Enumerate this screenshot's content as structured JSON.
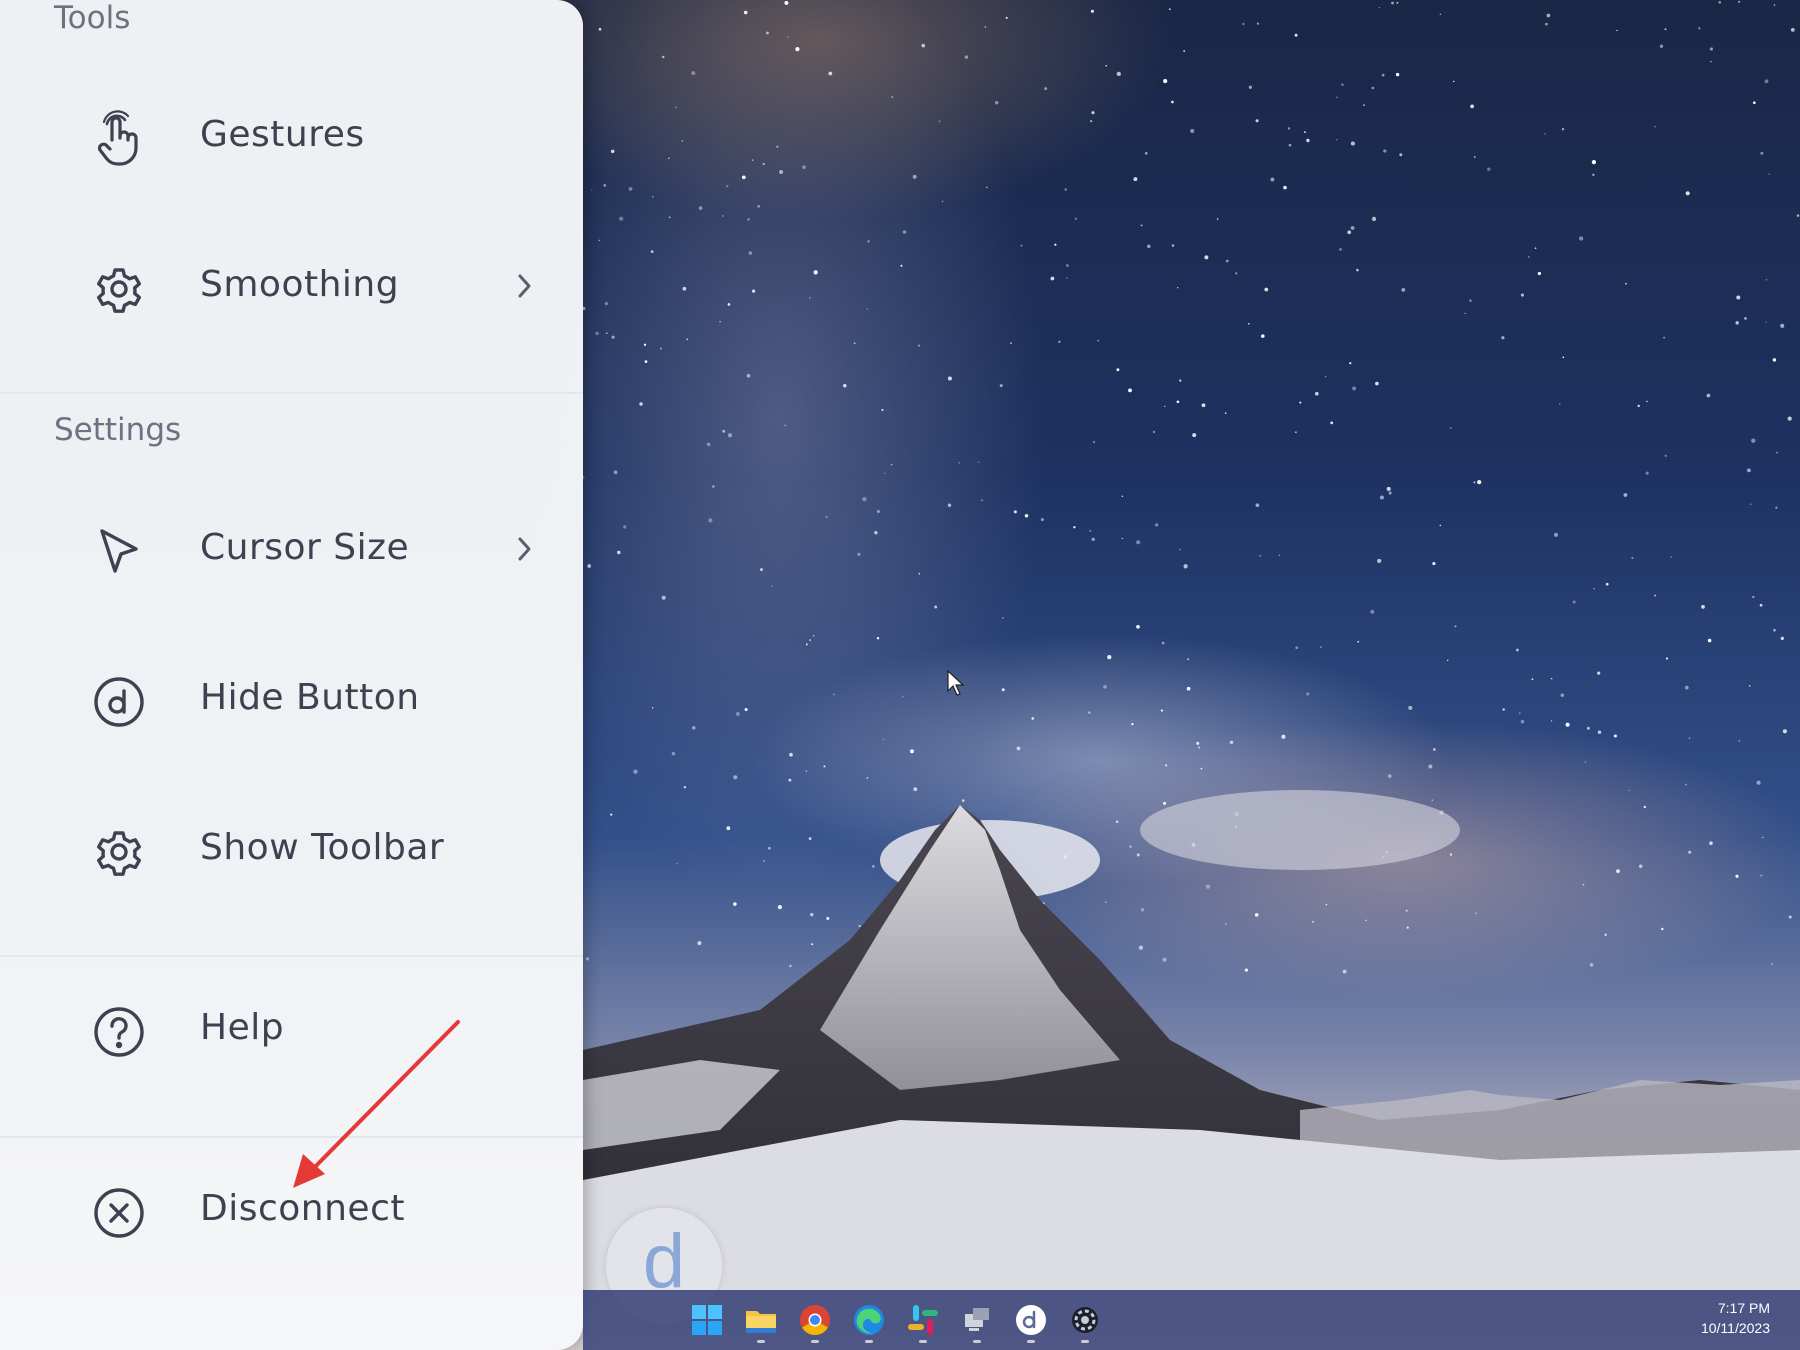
{
  "panel": {
    "tools_label": "Tools",
    "settings_label": "Settings",
    "items": [
      {
        "label": "Gestures",
        "icon": "gesture-hand-icon",
        "has_submenu": false
      },
      {
        "label": "Smoothing",
        "icon": "gear-icon",
        "has_submenu": true
      },
      {
        "label": "Cursor Size",
        "icon": "cursor-arrow-icon",
        "has_submenu": true
      },
      {
        "label": "Hide Button",
        "icon": "d-circle-icon",
        "has_submenu": false
      },
      {
        "label": "Show Toolbar",
        "icon": "gear-icon",
        "has_submenu": false
      },
      {
        "label": "Help",
        "icon": "help-circle-icon",
        "has_submenu": false
      },
      {
        "label": "Disconnect",
        "icon": "close-circle-icon",
        "has_submenu": false
      }
    ]
  },
  "floating_button": {
    "glyph": "d"
  },
  "annotation": {
    "color": "#e53935"
  },
  "taskbar": {
    "apps": [
      "windows-start-icon",
      "file-explorer-icon",
      "chrome-icon",
      "edge-icon",
      "slack-icon",
      "remote-desktop-icon",
      "duet-icon",
      "settings-icon"
    ],
    "clock": {
      "time": "7:17 PM",
      "date": "10/11/2023"
    }
  },
  "colors": {
    "panel_bg": "#f6f7f9",
    "text": "#3d4250",
    "section_label": "#6d7280",
    "taskbar": "#3a447a"
  }
}
